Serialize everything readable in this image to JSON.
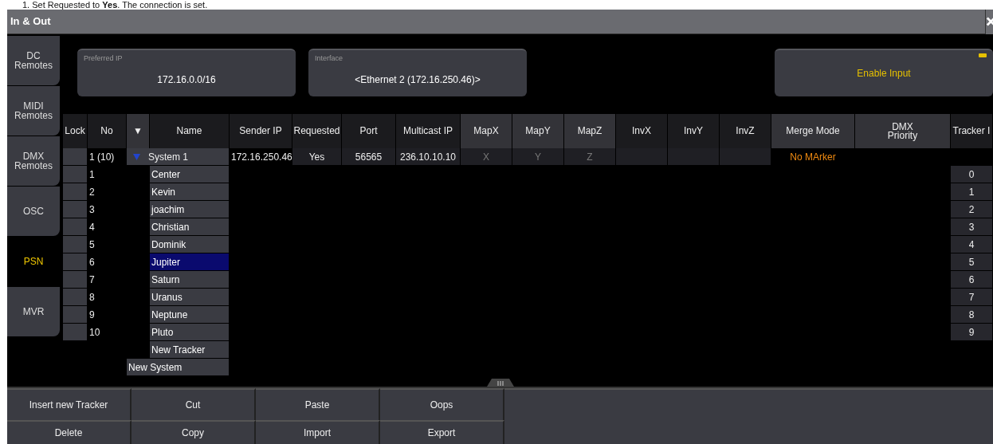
{
  "document_text": "1.  Set Requested to **Yes**. The connection is set.",
  "window": {
    "title": "In & Out"
  },
  "sidebar": {
    "tabs": [
      {
        "label": "DC Remotes",
        "selected": false
      },
      {
        "label": "MIDI Remotes",
        "selected": false
      },
      {
        "label": "DMX Remotes",
        "selected": false
      },
      {
        "label": "OSC",
        "selected": false
      },
      {
        "label": "PSN",
        "selected": true
      },
      {
        "label": "MVR",
        "selected": false
      }
    ]
  },
  "fields": [
    {
      "label": "Preferred IP",
      "value": "172.16.0.0/16"
    },
    {
      "label": "Interface",
      "value": "<Ethernet 2 (172.16.250.46)>"
    }
  ],
  "enable_input": {
    "label": "Enable Input",
    "on": true
  },
  "table": {
    "columns": [
      {
        "label": "Lock",
        "highlighted": false
      },
      {
        "label": "No",
        "highlighted": false
      },
      {
        "label": "▼",
        "highlighted": true
      },
      {
        "label": "Name",
        "highlighted": false
      },
      {
        "label": "Sender IP",
        "highlighted": false
      },
      {
        "label": "Requested",
        "highlighted": false
      },
      {
        "label": "Port",
        "highlighted": false
      },
      {
        "label": "Multicast IP",
        "highlighted": false
      },
      {
        "label": "MapX",
        "highlighted": true
      },
      {
        "label": "MapY",
        "highlighted": true
      },
      {
        "label": "MapZ",
        "highlighted": true
      },
      {
        "label": "InvX",
        "highlighted": false
      },
      {
        "label": "InvY",
        "highlighted": false
      },
      {
        "label": "InvZ",
        "highlighted": false
      },
      {
        "label": "Merge Mode",
        "highlighted": true
      },
      {
        "label": "DMX\nPriority",
        "highlighted": true
      },
      {
        "label": "Tracker I",
        "highlighted": false
      }
    ],
    "system": {
      "no": "1 (10)",
      "name": "System 1",
      "expanded": true,
      "sender_ip": "172.16.250.46",
      "requested": "Yes",
      "port": "56565",
      "multicast_ip": "236.10.10.10",
      "map_x": "X",
      "map_y": "Y",
      "map_z": "Z",
      "merge_mode": "No MArker"
    },
    "trackers": [
      {
        "no": "1",
        "name": "Center",
        "tracker_id": "0",
        "selected": false
      },
      {
        "no": "2",
        "name": "Kevin",
        "tracker_id": "1",
        "selected": false
      },
      {
        "no": "3",
        "name": "joachim",
        "tracker_id": "2",
        "selected": false
      },
      {
        "no": "4",
        "name": "Christian",
        "tracker_id": "3",
        "selected": false
      },
      {
        "no": "5",
        "name": "Dominik",
        "tracker_id": "4",
        "selected": false
      },
      {
        "no": "6",
        "name": "Jupiter",
        "tracker_id": "5",
        "selected": true
      },
      {
        "no": "7",
        "name": "Saturn",
        "tracker_id": "6",
        "selected": false
      },
      {
        "no": "8",
        "name": "Uranus",
        "tracker_id": "7",
        "selected": false
      },
      {
        "no": "9",
        "name": "Neptune",
        "tracker_id": "8",
        "selected": false
      },
      {
        "no": "10",
        "name": "Pluto",
        "tracker_id": "9",
        "selected": false
      }
    ],
    "new_tracker": "New Tracker",
    "new_system": "New System"
  },
  "buttons": [
    "Insert new Tracker",
    "Cut",
    "Paste",
    "Oops",
    "Delete",
    "Copy",
    "Import",
    "Export"
  ]
}
